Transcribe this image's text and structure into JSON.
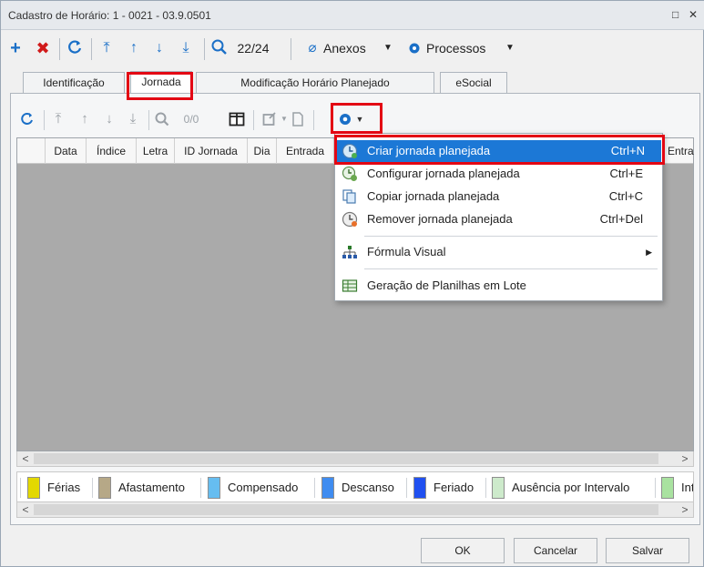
{
  "window": {
    "title": "Cadastro de Horário: 1 - 0021 - 03.9.0501",
    "controls": [
      "□",
      "✕"
    ]
  },
  "toolbar": {
    "counter": "22/24",
    "attachments_label": "Anexos",
    "processes_label": "Processos"
  },
  "tabs": [
    {
      "label": "Identificação"
    },
    {
      "label": "Jornada"
    },
    {
      "label": "Modificação Horário Planejado"
    },
    {
      "label": "eSocial"
    }
  ],
  "subtoolbar": {
    "counter": "0/0"
  },
  "grid": {
    "columns": [
      "Data",
      "Índice",
      "Letra",
      "ID Jornada",
      "Dia",
      "Entrada",
      "Entra"
    ]
  },
  "menu": {
    "items": [
      {
        "label": "Criar jornada planejada",
        "shortcut": "Ctrl+N",
        "highlighted": true,
        "icon": "create-clock-icon"
      },
      {
        "label": "Configurar jornada planejada",
        "shortcut": "Ctrl+E",
        "highlighted": false,
        "icon": "configure-clock-icon"
      },
      {
        "label": "Copiar jornada planejada",
        "shortcut": "Ctrl+C",
        "highlighted": false,
        "icon": "copy-icon"
      },
      {
        "label": "Remover jornada planejada",
        "shortcut": "Ctrl+Del",
        "highlighted": false,
        "icon": "remove-clock-icon"
      },
      {
        "label": "Fórmula Visual",
        "shortcut": "",
        "submenu": true,
        "highlighted": false,
        "icon": "formula-icon"
      },
      {
        "label": "Geração de Planilhas em Lote",
        "shortcut": "",
        "highlighted": false,
        "icon": "spreadsheet-icon"
      }
    ]
  },
  "legend": {
    "items": [
      {
        "label": "Férias",
        "color": "#e3d800"
      },
      {
        "label": "Afastamento",
        "color": "#b6a887"
      },
      {
        "label": "Compensado",
        "color": "#66bdf0"
      },
      {
        "label": "Descanso",
        "color": "#3f8cf0"
      },
      {
        "label": "Feriado",
        "color": "#2050f0"
      },
      {
        "label": "Ausência por Intervalo",
        "color": "#cdeacb"
      },
      {
        "label": "Int",
        "color": "#a9e2a0"
      }
    ]
  },
  "buttons": {
    "ok": "OK",
    "cancel": "Cancelar",
    "save": "Salvar"
  },
  "colors": {
    "accent": "#1c78d6",
    "highlight_box": "#e30613",
    "grid_background": "#aaaaaa"
  }
}
